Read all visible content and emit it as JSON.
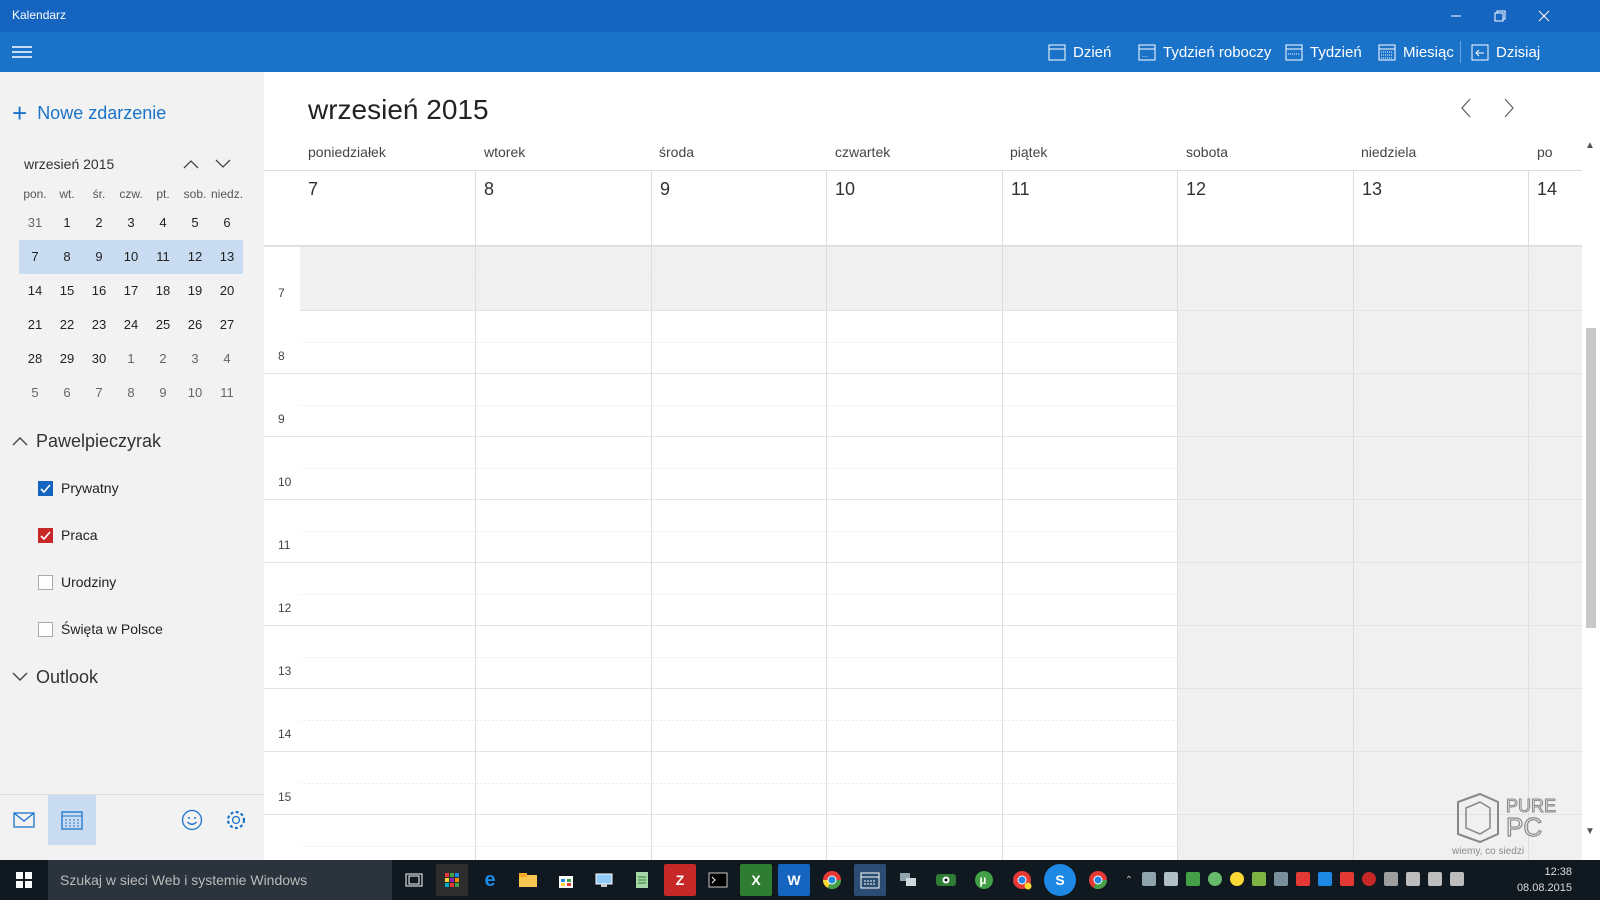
{
  "window": {
    "title": "Kalendarz"
  },
  "toolbar": {
    "views": [
      {
        "label": "Dzień",
        "icon": "day-view-icon"
      },
      {
        "label": "Tydzień roboczy",
        "icon": "work-week-icon"
      },
      {
        "label": "Tydzień",
        "icon": "week-icon"
      },
      {
        "label": "Miesiąc",
        "icon": "month-icon"
      },
      {
        "label": "Dzisiaj",
        "icon": "today-icon"
      }
    ]
  },
  "sidebar": {
    "new_event": "Nowe zdarzenie",
    "mini_calendar": {
      "title": "wrzesień 2015",
      "weekdays": [
        "pon.",
        "wt.",
        "śr.",
        "czw.",
        "pt.",
        "sob.",
        "niedz."
      ],
      "weeks": [
        [
          "31",
          "1",
          "2",
          "3",
          "4",
          "5",
          "6"
        ],
        [
          "7",
          "8",
          "9",
          "10",
          "11",
          "12",
          "13"
        ],
        [
          "14",
          "15",
          "16",
          "17",
          "18",
          "19",
          "20"
        ],
        [
          "21",
          "22",
          "23",
          "24",
          "25",
          "26",
          "27"
        ],
        [
          "28",
          "29",
          "30",
          "1",
          "2",
          "3",
          "4"
        ],
        [
          "5",
          "6",
          "7",
          "8",
          "9",
          "10",
          "11"
        ]
      ],
      "selected_week": 1
    },
    "account": "Pawelpieczyrak",
    "calendars": [
      {
        "label": "Prywatny",
        "checked": true,
        "color": "#1565c0"
      },
      {
        "label": "Praca",
        "checked": true,
        "color": "#c62828"
      },
      {
        "label": "Urodziny",
        "checked": false,
        "color": "#999999"
      },
      {
        "label": "Święta w Polsce",
        "checked": false,
        "color": "#999999"
      }
    ],
    "account2": "Outlook"
  },
  "main": {
    "title": "wrzesień 2015",
    "days": [
      {
        "name": "poniedziałek",
        "date": "7"
      },
      {
        "name": "wtorek",
        "date": "8"
      },
      {
        "name": "środa",
        "date": "9"
      },
      {
        "name": "czwartek",
        "date": "10"
      },
      {
        "name": "piątek",
        "date": "11"
      },
      {
        "name": "sobota",
        "date": "12"
      },
      {
        "name": "niedziela",
        "date": "13"
      },
      {
        "name": "po",
        "date": "14"
      }
    ],
    "hours": [
      "7",
      "8",
      "9",
      "10",
      "11",
      "12",
      "13",
      "14",
      "15"
    ]
  },
  "taskbar": {
    "search_placeholder": "Szukaj w sieci Web i systemie Windows",
    "clock_time": "12:38",
    "clock_date": "08.08.2015"
  },
  "watermark": {
    "line1": "PURE",
    "line2": "PC",
    "tagline": "wiemy, co siedzi"
  },
  "colors": {
    "titlebar": "#1565c0",
    "toolbar": "#1a73c9",
    "accent": "#1a73c9",
    "selection": "#c9dcf1"
  }
}
